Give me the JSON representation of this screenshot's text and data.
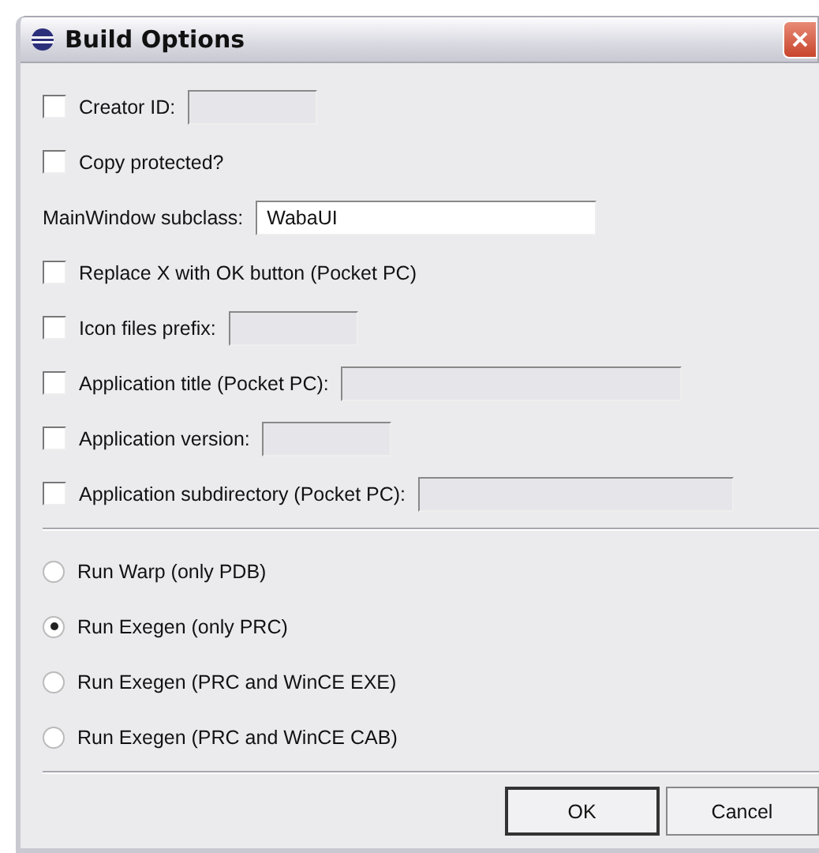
{
  "window": {
    "title": "Build Options"
  },
  "options": [
    {
      "kind": "checkbox_short_field",
      "label": "Creator ID:",
      "checked": false,
      "disabled": true
    },
    {
      "kind": "checkbox",
      "label": "Copy protected?",
      "checked": false
    },
    {
      "kind": "text_field",
      "label": "MainWindow subclass:",
      "value": "WabaUI",
      "disabled": false
    },
    {
      "kind": "checkbox",
      "label": "Replace X with OK button (Pocket PC)",
      "checked": false
    },
    {
      "kind": "checkbox_short_field",
      "label": "Icon files prefix:",
      "checked": false,
      "disabled": true
    },
    {
      "kind": "checkbox_long_field",
      "label": "Application title (Pocket PC):",
      "checked": false,
      "disabled": true
    },
    {
      "kind": "checkbox_short_field",
      "label": "Application version:",
      "checked": false,
      "disabled": true
    },
    {
      "kind": "checkbox_fill_field",
      "label": "Application subdirectory (Pocket PC):",
      "checked": false,
      "disabled": true
    }
  ],
  "modes": [
    {
      "label": "Run Warp (only PDB)",
      "selected": false
    },
    {
      "label": "Run Exegen (only PRC)",
      "selected": true
    },
    {
      "label": "Run Exegen (PRC and WinCE EXE)",
      "selected": false
    },
    {
      "label": "Run Exegen (PRC and WinCE CAB)",
      "selected": false
    }
  ],
  "buttons": [
    {
      "label": "OK",
      "default": true
    },
    {
      "label": "Cancel",
      "default": false
    }
  ]
}
